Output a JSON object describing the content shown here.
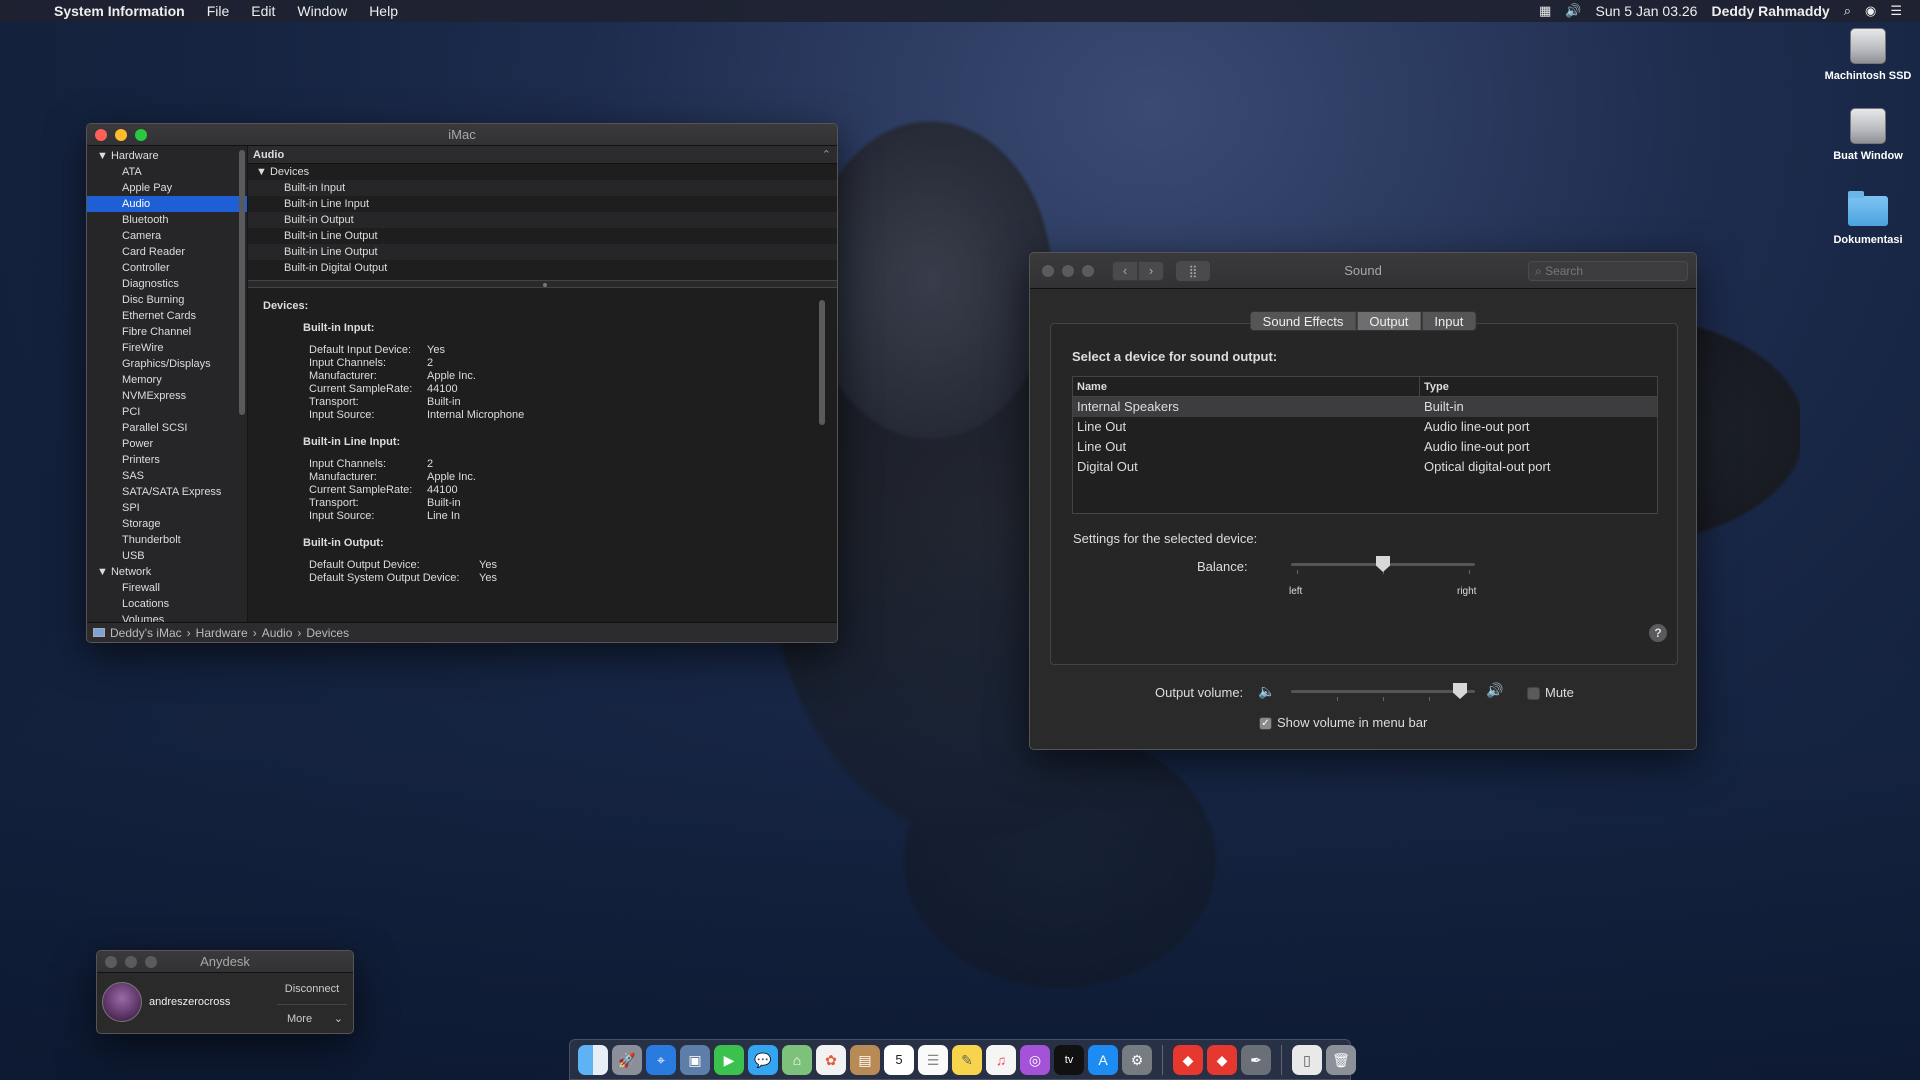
{
  "menubar": {
    "app_name": "System Information",
    "menus": [
      "File",
      "Edit",
      "Window",
      "Help"
    ],
    "datetime": "Sun 5 Jan  03.26",
    "user": "Deddy Rahmaddy"
  },
  "desktop": {
    "icons": [
      {
        "label": "Machintosh SSD",
        "icon": "drive-icon"
      },
      {
        "label": "Buat Window",
        "icon": "drive-icon"
      },
      {
        "label": "Dokumentasi",
        "icon": "folder-icon"
      }
    ]
  },
  "sysinfo": {
    "title": "iMac",
    "sidebar": {
      "hardware_label": "Hardware",
      "hardware_items": [
        "ATA",
        "Apple Pay",
        "Audio",
        "Bluetooth",
        "Camera",
        "Card Reader",
        "Controller",
        "Diagnostics",
        "Disc Burning",
        "Ethernet Cards",
        "Fibre Channel",
        "FireWire",
        "Graphics/Displays",
        "Memory",
        "NVMExpress",
        "PCI",
        "Parallel SCSI",
        "Power",
        "Printers",
        "SAS",
        "SATA/SATA Express",
        "SPI",
        "Storage",
        "Thunderbolt",
        "USB"
      ],
      "selected": "Audio",
      "network_label": "Network",
      "network_items": [
        "Firewall",
        "Locations",
        "Volumes"
      ]
    },
    "section_title": "Audio",
    "devices_group": "Devices",
    "devices": [
      "Built-in Input",
      "Built-in Line Input",
      "Built-in Output",
      "Built-in Line Output",
      "Built-in Line Output",
      "Built-in Digital Output"
    ],
    "detail": {
      "heading": "Devices:",
      "builtin_input": {
        "title": "Built-in Input:",
        "rows": [
          [
            "Default Input Device:",
            "Yes"
          ],
          [
            "Input Channels:",
            "2"
          ],
          [
            "Manufacturer:",
            "Apple Inc."
          ],
          [
            "Current SampleRate:",
            "44100"
          ],
          [
            "Transport:",
            "Built-in"
          ],
          [
            "Input Source:",
            "Internal Microphone"
          ]
        ]
      },
      "builtin_line_input": {
        "title": "Built-in Line Input:",
        "rows": [
          [
            "Input Channels:",
            "2"
          ],
          [
            "Manufacturer:",
            "Apple Inc."
          ],
          [
            "Current SampleRate:",
            "44100"
          ],
          [
            "Transport:",
            "Built-in"
          ],
          [
            "Input Source:",
            "Line In"
          ]
        ]
      },
      "builtin_output": {
        "title": "Built-in Output:",
        "rows": [
          [
            "Default Output Device:",
            "Yes"
          ],
          [
            "Default System Output Device:",
            "Yes"
          ]
        ]
      }
    },
    "path": [
      "Deddy's iMac",
      "Hardware",
      "Audio",
      "Devices"
    ]
  },
  "sound": {
    "title": "Sound",
    "search_placeholder": "Search",
    "tabs": [
      "Sound Effects",
      "Output",
      "Input"
    ],
    "selected_tab": "Output",
    "select_label": "Select a device for sound output:",
    "columns": [
      "Name",
      "Type"
    ],
    "devices": [
      {
        "name": "Internal Speakers",
        "type": "Built-in"
      },
      {
        "name": "Line Out",
        "type": "Audio line-out port"
      },
      {
        "name": "Line Out",
        "type": "Audio line-out port"
      },
      {
        "name": "Digital Out",
        "type": "Optical digital-out port"
      }
    ],
    "settings_label": "Settings for the selected device:",
    "balance_label": "Balance:",
    "balance_left": "left",
    "balance_right": "right",
    "balance_value": 0.5,
    "help_label": "?",
    "output_volume_label": "Output volume:",
    "output_volume_value": 0.95,
    "mute_label": "Mute",
    "mute_checked": false,
    "show_volume_label": "Show volume in menu bar",
    "show_volume_checked": true
  },
  "anydesk": {
    "title": "Anydesk",
    "user": "andreszerocross",
    "disconnect_label": "Disconnect",
    "more_label": "More"
  },
  "dock": {
    "apps": [
      "finder-icon",
      "launchpad-icon",
      "safari-icon",
      "preview-icon",
      "facetime-icon",
      "messages-icon",
      "maps-icon",
      "photos-icon",
      "contacts-icon",
      "calendar-icon",
      "reminders-icon",
      "notes-icon",
      "music-icon",
      "podcasts-icon",
      "tv-icon",
      "app-store-icon",
      "system-preferences-icon",
      "anydesk-icon",
      "anydesk-icon-2",
      "script-editor-icon",
      "document-icon",
      "trash-icon"
    ],
    "calendar_day": "5"
  },
  "colors": {
    "accent": "#1f5fd6",
    "close": "#fe5f57",
    "minimize": "#febc2e",
    "zoom": "#28c840"
  }
}
